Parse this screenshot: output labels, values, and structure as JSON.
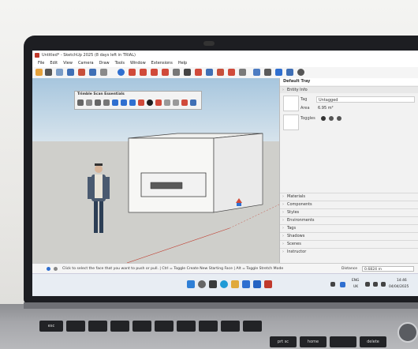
{
  "window": {
    "title": "Untitled* - SketchUp 2025 (8 days left in TRIAL)"
  },
  "menu": [
    "File",
    "Edit",
    "View",
    "Camera",
    "Draw",
    "Tools",
    "Window",
    "Extensions",
    "Help"
  ],
  "floating_toolbar": {
    "title": "Trimble Scan Essentials"
  },
  "tray": {
    "title": "Default Tray",
    "entity_info": {
      "header": "Entity Info",
      "tag_label": "Tag",
      "tag_value": "Untagged",
      "area_label": "Area",
      "area_value": "6.95 m²",
      "toggles_label": "Toggles"
    },
    "panels": [
      "Materials",
      "Components",
      "Styles",
      "Environments",
      "Tags",
      "Shadows",
      "Scenes",
      "Instructor"
    ]
  },
  "status": {
    "message": "Click to select the face that you want to push or pull. | Ctrl = Toggle Create New Starting Face | Alt = Toggle Stretch Mode",
    "distance_label": "Distance",
    "distance_value": "0.6824 m"
  },
  "taskbar": {
    "lang": "ENG",
    "region": "UK",
    "time": "14:46",
    "date": "04/04/2025"
  },
  "keyboard": {
    "esc": "esc",
    "prt_sc": "prt sc",
    "home": "home",
    "delete": "delete"
  },
  "colors": {
    "accent": "#1e73be",
    "ground": "#cfcfcb",
    "sky": "#a7c6de"
  }
}
